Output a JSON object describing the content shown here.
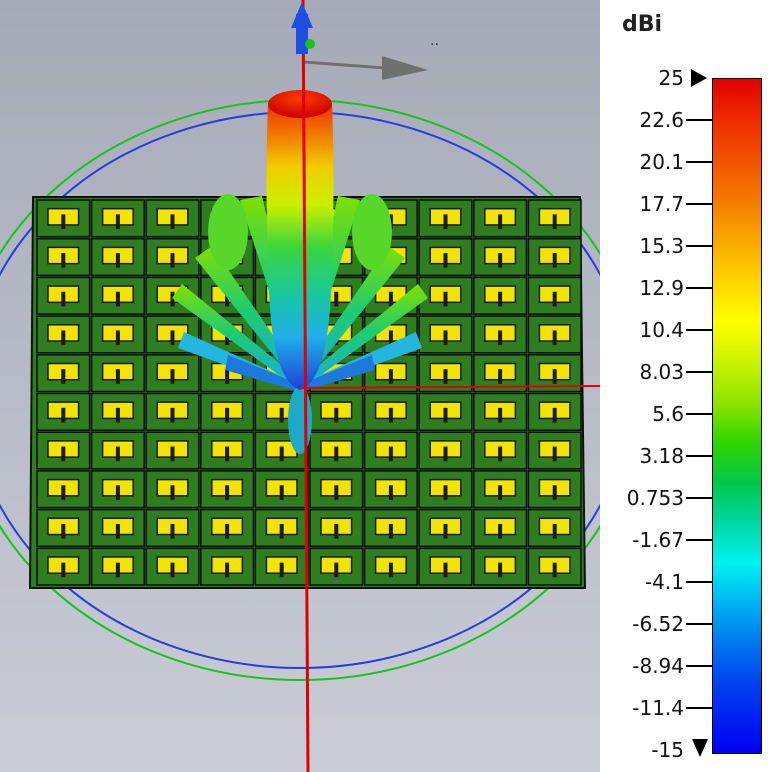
{
  "legend": {
    "unit": "dBi",
    "ticks": [
      "25",
      "22.6",
      "20.1",
      "17.7",
      "15.3",
      "12.9",
      "10.4",
      "8.03",
      "5.6",
      "3.18",
      "0.753",
      "-1.67",
      "-4.1",
      "-6.52",
      "-8.94",
      "-11.4",
      "-15"
    ],
    "min": -15,
    "max": 25
  },
  "scene": {
    "axis_label": "..",
    "array_rows": 10,
    "array_cols": 10,
    "colors": {
      "background_top": "#a6aab8",
      "background_bottom": "#cacdd6",
      "substrate": "#2e7d1e",
      "patch": "#f2e400",
      "axis_red": "#e00000",
      "axis_blue": "#1f4fe0",
      "axis_gray": "#707070",
      "ring_green": "#19c419",
      "ring_blue": "#2a3cdc"
    }
  }
}
